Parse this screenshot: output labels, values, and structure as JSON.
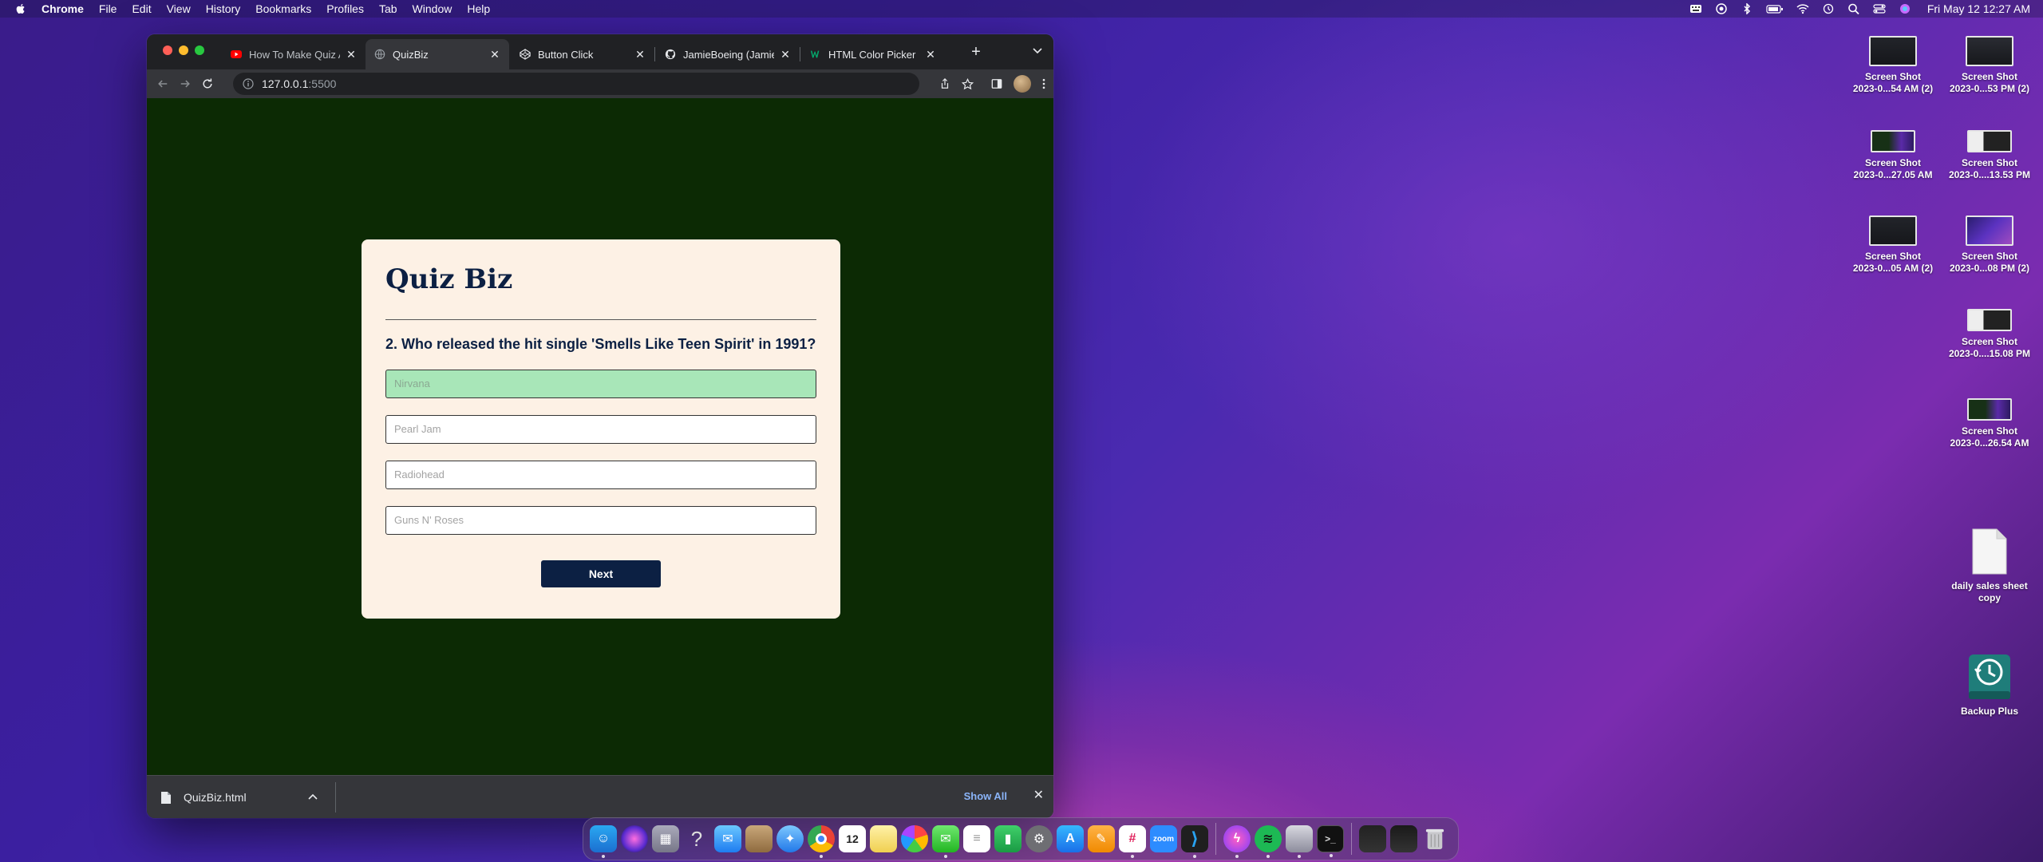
{
  "menubar": {
    "app_name": "Chrome",
    "items": [
      "File",
      "Edit",
      "View",
      "History",
      "Bookmarks",
      "Profiles",
      "Tab",
      "Window",
      "Help"
    ],
    "clock": "Fri May 12  12:27 AM"
  },
  "browser": {
    "tabs": [
      {
        "title": "How To Make Quiz App",
        "favicon": "youtube-icon"
      },
      {
        "title": "QuizBiz",
        "favicon": "globe-icon"
      },
      {
        "title": "Button Click",
        "favicon": "codepen-icon"
      },
      {
        "title": "JamieBoeing (Jamie",
        "favicon": "github-icon"
      },
      {
        "title": "HTML Color Picker",
        "favicon": "w3schools-icon"
      }
    ],
    "address": {
      "host": "127.0.0.1",
      "port": ":5500"
    }
  },
  "quiz": {
    "title": "Quiz Biz",
    "question": "2. Who released the hit single 'Smells Like Teen Spirit' in 1991?",
    "answers": [
      {
        "label": "Nirvana",
        "state": "correct"
      },
      {
        "label": "Pearl Jam",
        "state": "default"
      },
      {
        "label": "Radiohead",
        "state": "default"
      },
      {
        "label": "Guns N' Roses",
        "state": "default"
      }
    ],
    "next_label": "Next"
  },
  "downloads": {
    "file_name": "QuizBiz.html",
    "show_all": "Show All"
  },
  "desktop": {
    "icons": [
      {
        "line1": "Screen Shot",
        "line2": "2023-0...54 AM (2)"
      },
      {
        "line1": "Screen Shot",
        "line2": "2023-0...53 PM (2)"
      },
      {
        "line1": "Screen Shot",
        "line2": "2023-0...27.05 AM"
      },
      {
        "line1": "Screen Shot",
        "line2": "2023-0....13.53 PM"
      },
      {
        "line1": "Screen Shot",
        "line2": "2023-0...05 AM (2)"
      },
      {
        "line1": "Screen Shot",
        "line2": "2023-0...08 PM (2)"
      },
      {
        "line1": "Screen Shot",
        "line2": "2023-0....15.08 PM"
      },
      {
        "line1": "Screen Shot",
        "line2": "2023-0...26.54 AM"
      },
      {
        "line1": "daily sales sheet",
        "line2": "copy"
      },
      {
        "line1": "Backup Plus",
        "line2": ""
      }
    ]
  },
  "colors": {
    "page_bg": "#0c2a04",
    "card_bg": "#fdf1e5",
    "primary_navy": "#0c2043",
    "correct_green": "#a8e6b8"
  }
}
